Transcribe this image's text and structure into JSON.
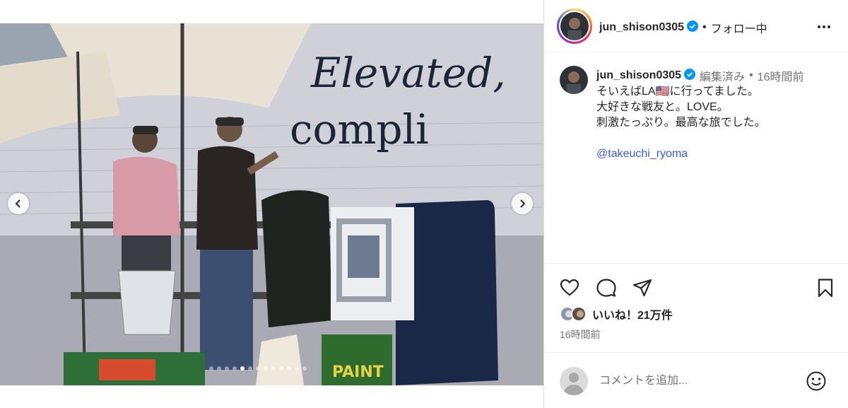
{
  "post": {
    "username": "jun_shison0305",
    "follow_status": "フォロー中",
    "separator": "•"
  },
  "caption": {
    "username": "jun_shison0305",
    "edited": "編集済み",
    "separator": "•",
    "time": "16時間前",
    "lines": [
      "そいえばLA🇺🇸に行ってました。",
      "大好きな戦友と。LOVE。",
      "刺激たっぷり。最高な旅でした。"
    ],
    "mention": "@takeuchi_ryoma"
  },
  "photo": {
    "wall_text_line1": "Elevated,",
    "wall_text_line2": "compli",
    "sign_text": "PAINT"
  },
  "carousel": {
    "total_slides": 13,
    "active_slide": 4
  },
  "likes": {
    "text": "いいね！21万件"
  },
  "post_time": "16時間前",
  "comment": {
    "placeholder": "コメントを追加..."
  },
  "icons": {
    "like": "heart-icon",
    "comment": "comment-bubble-icon",
    "share": "paper-plane-icon",
    "save": "bookmark-icon",
    "emoji": "smiley-icon",
    "verified": "verified-badge-icon",
    "more": "more-dots-icon",
    "prev": "chevron-left-icon",
    "next": "chevron-right-icon"
  },
  "colors": {
    "verified": "#0095f6",
    "mention": "#3b5bdb",
    "secondary_text": "#737373"
  }
}
